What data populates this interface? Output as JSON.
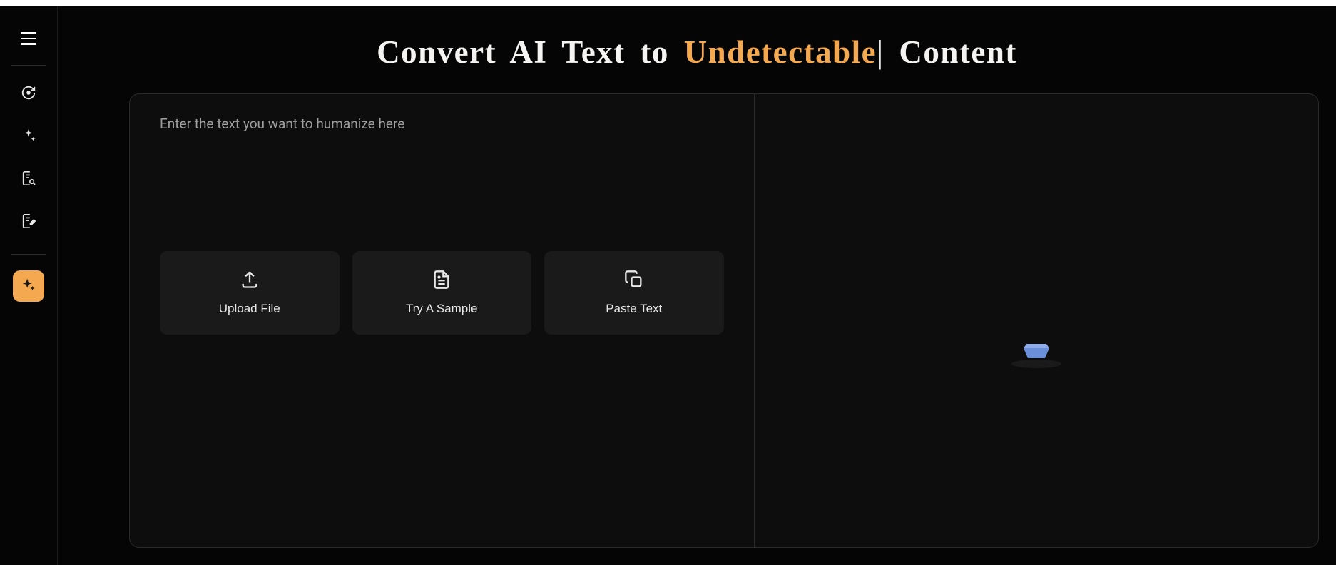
{
  "title": {
    "prefix": "Convert AI Text to ",
    "accent": "Undetectable",
    "suffix": " Content"
  },
  "input": {
    "placeholder": "Enter the text you want to humanize here",
    "value": ""
  },
  "actions": {
    "upload": "Upload File",
    "sample": "Try A Sample",
    "paste": "Paste Text"
  },
  "sidebar": {
    "items": [
      {
        "name": "refresh"
      },
      {
        "name": "sparkle"
      },
      {
        "name": "document-search"
      },
      {
        "name": "document-edit"
      },
      {
        "name": "ai-sparkle",
        "active": true
      }
    ]
  },
  "colors": {
    "accent": "#f4a950",
    "background": "#050505",
    "panel": "#0d0d0d",
    "button": "#1a1a1a"
  }
}
